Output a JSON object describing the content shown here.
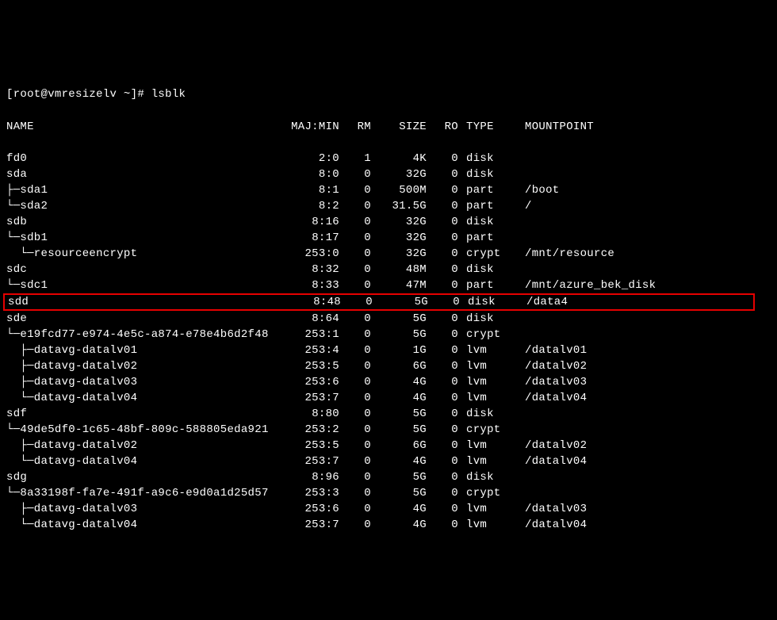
{
  "prompt": "[root@vmresizelv ~]#",
  "command": "lsblk",
  "headers": {
    "name": "NAME",
    "majmin": "MAJ:MIN",
    "rm": "RM",
    "size": "SIZE",
    "ro": "RO",
    "type": "TYPE",
    "mountpoint": "MOUNTPOINT"
  },
  "rows": [
    {
      "name": "fd0",
      "majmin": "2:0",
      "rm": "1",
      "size": "4K",
      "ro": "0",
      "type": "disk",
      "mnt": "",
      "hl": false
    },
    {
      "name": "sda",
      "majmin": "8:0",
      "rm": "0",
      "size": "32G",
      "ro": "0",
      "type": "disk",
      "mnt": "",
      "hl": false
    },
    {
      "name": "├─sda1",
      "majmin": "8:1",
      "rm": "0",
      "size": "500M",
      "ro": "0",
      "type": "part",
      "mnt": "/boot",
      "hl": false
    },
    {
      "name": "└─sda2",
      "majmin": "8:2",
      "rm": "0",
      "size": "31.5G",
      "ro": "0",
      "type": "part",
      "mnt": "/",
      "hl": false
    },
    {
      "name": "sdb",
      "majmin": "8:16",
      "rm": "0",
      "size": "32G",
      "ro": "0",
      "type": "disk",
      "mnt": "",
      "hl": false
    },
    {
      "name": "└─sdb1",
      "majmin": "8:17",
      "rm": "0",
      "size": "32G",
      "ro": "0",
      "type": "part",
      "mnt": "",
      "hl": false
    },
    {
      "name": "  └─resourceencrypt",
      "majmin": "253:0",
      "rm": "0",
      "size": "32G",
      "ro": "0",
      "type": "crypt",
      "mnt": "/mnt/resource",
      "hl": false
    },
    {
      "name": "sdc",
      "majmin": "8:32",
      "rm": "0",
      "size": "48M",
      "ro": "0",
      "type": "disk",
      "mnt": "",
      "hl": false
    },
    {
      "name": "└─sdc1",
      "majmin": "8:33",
      "rm": "0",
      "size": "47M",
      "ro": "0",
      "type": "part",
      "mnt": "/mnt/azure_bek_disk",
      "hl": false
    },
    {
      "name": "sdd",
      "majmin": "8:48",
      "rm": "0",
      "size": "5G",
      "ro": "0",
      "type": "disk",
      "mnt": "/data4",
      "hl": true
    },
    {
      "name": "sde",
      "majmin": "8:64",
      "rm": "0",
      "size": "5G",
      "ro": "0",
      "type": "disk",
      "mnt": "",
      "hl": false
    },
    {
      "name": "└─e19fcd77-e974-4e5c-a874-e78e4b6d2f48",
      "majmin": "253:1",
      "rm": "0",
      "size": "5G",
      "ro": "0",
      "type": "crypt",
      "mnt": "",
      "hl": false
    },
    {
      "name": "  ├─datavg-datalv01",
      "majmin": "253:4",
      "rm": "0",
      "size": "1G",
      "ro": "0",
      "type": "lvm",
      "mnt": "/datalv01",
      "hl": false
    },
    {
      "name": "  ├─datavg-datalv02",
      "majmin": "253:5",
      "rm": "0",
      "size": "6G",
      "ro": "0",
      "type": "lvm",
      "mnt": "/datalv02",
      "hl": false
    },
    {
      "name": "  ├─datavg-datalv03",
      "majmin": "253:6",
      "rm": "0",
      "size": "4G",
      "ro": "0",
      "type": "lvm",
      "mnt": "/datalv03",
      "hl": false
    },
    {
      "name": "  └─datavg-datalv04",
      "majmin": "253:7",
      "rm": "0",
      "size": "4G",
      "ro": "0",
      "type": "lvm",
      "mnt": "/datalv04",
      "hl": false
    },
    {
      "name": "sdf",
      "majmin": "8:80",
      "rm": "0",
      "size": "5G",
      "ro": "0",
      "type": "disk",
      "mnt": "",
      "hl": false
    },
    {
      "name": "└─49de5df0-1c65-48bf-809c-588805eda921",
      "majmin": "253:2",
      "rm": "0",
      "size": "5G",
      "ro": "0",
      "type": "crypt",
      "mnt": "",
      "hl": false
    },
    {
      "name": "  ├─datavg-datalv02",
      "majmin": "253:5",
      "rm": "0",
      "size": "6G",
      "ro": "0",
      "type": "lvm",
      "mnt": "/datalv02",
      "hl": false
    },
    {
      "name": "  └─datavg-datalv04",
      "majmin": "253:7",
      "rm": "0",
      "size": "4G",
      "ro": "0",
      "type": "lvm",
      "mnt": "/datalv04",
      "hl": false
    },
    {
      "name": "sdg",
      "majmin": "8:96",
      "rm": "0",
      "size": "5G",
      "ro": "0",
      "type": "disk",
      "mnt": "",
      "hl": false
    },
    {
      "name": "└─8a33198f-fa7e-491f-a9c6-e9d0a1d25d57",
      "majmin": "253:3",
      "rm": "0",
      "size": "5G",
      "ro": "0",
      "type": "crypt",
      "mnt": "",
      "hl": false
    },
    {
      "name": "  ├─datavg-datalv03",
      "majmin": "253:6",
      "rm": "0",
      "size": "4G",
      "ro": "0",
      "type": "lvm",
      "mnt": "/datalv03",
      "hl": false
    },
    {
      "name": "  └─datavg-datalv04",
      "majmin": "253:7",
      "rm": "0",
      "size": "4G",
      "ro": "0",
      "type": "lvm",
      "mnt": "/datalv04",
      "hl": false
    }
  ]
}
